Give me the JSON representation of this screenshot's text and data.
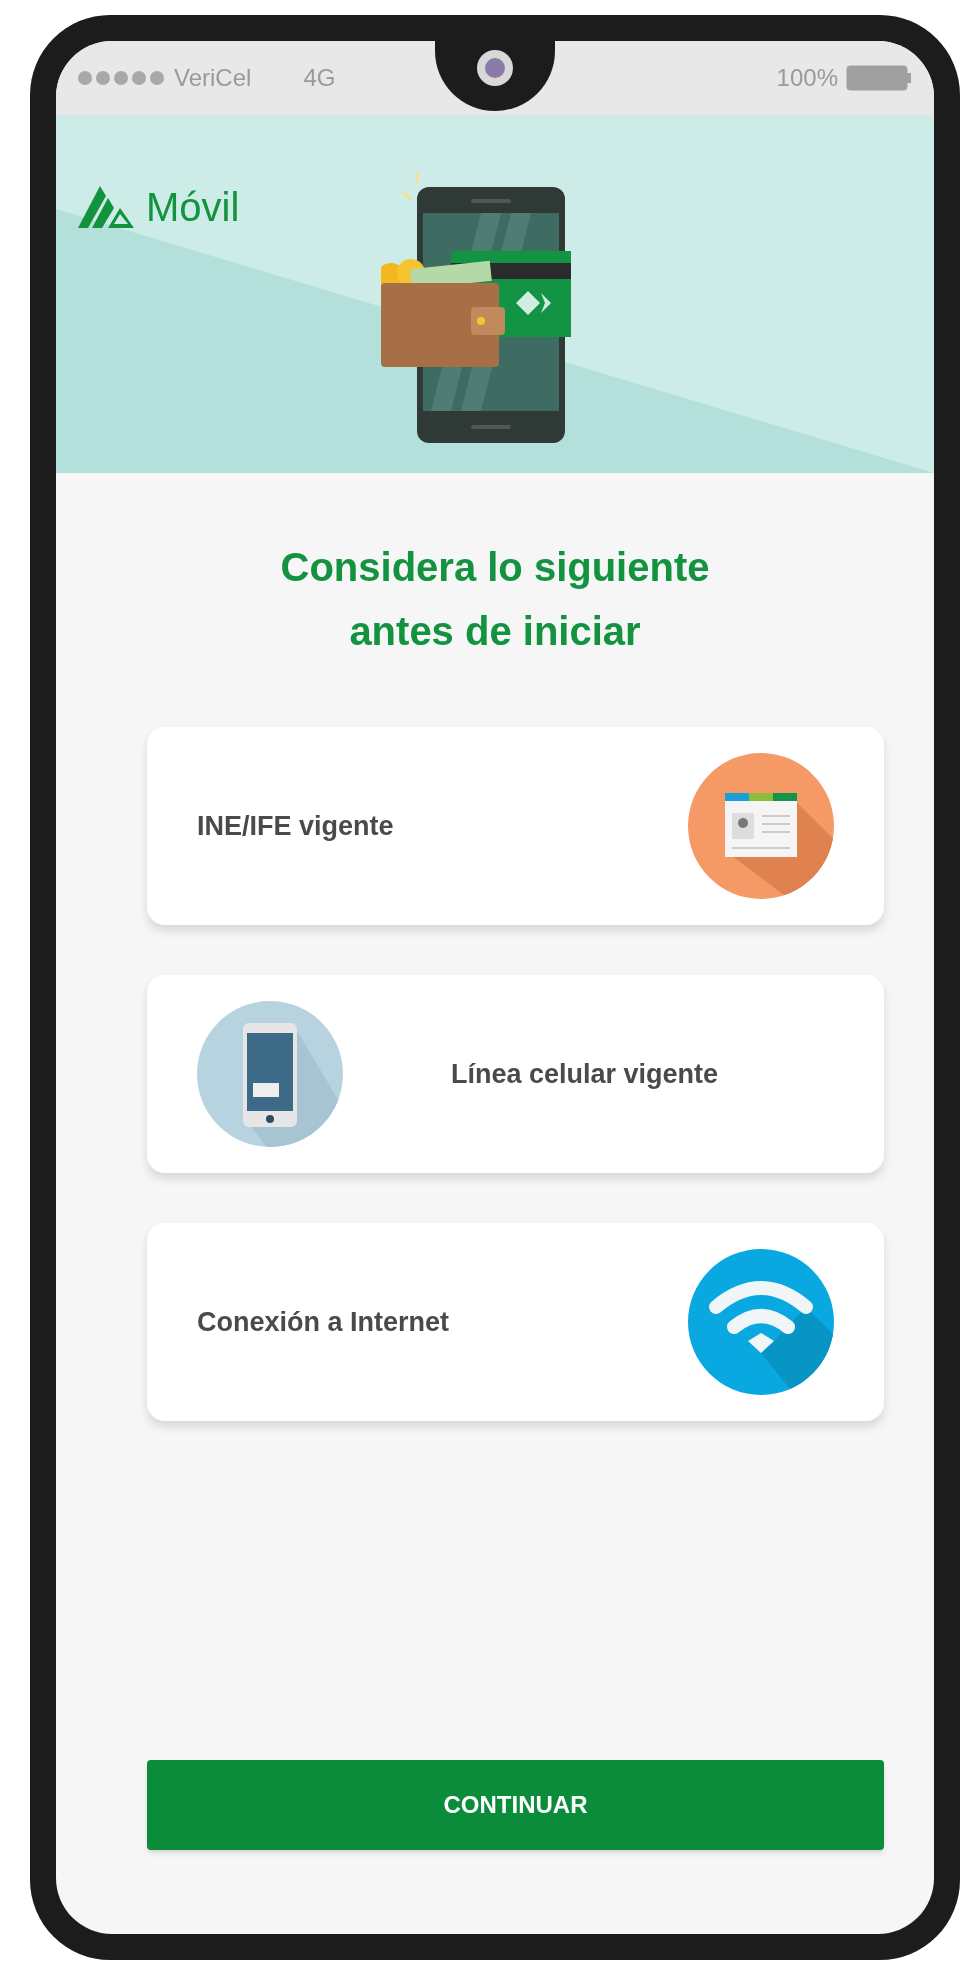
{
  "status_bar": {
    "carrier": "VeriCel",
    "network": "4G",
    "battery": "100%"
  },
  "header": {
    "logo_text": "Móvil"
  },
  "title": "Considera lo siguiente antes de iniciar",
  "requirements": [
    {
      "label": "INE/IFE vigente",
      "kind": "trailing"
    },
    {
      "label": "Línea celular vigente",
      "kind": "leading"
    },
    {
      "label": "Conexión a Internet",
      "kind": "trailing"
    }
  ],
  "button": "CONTINUAR"
}
